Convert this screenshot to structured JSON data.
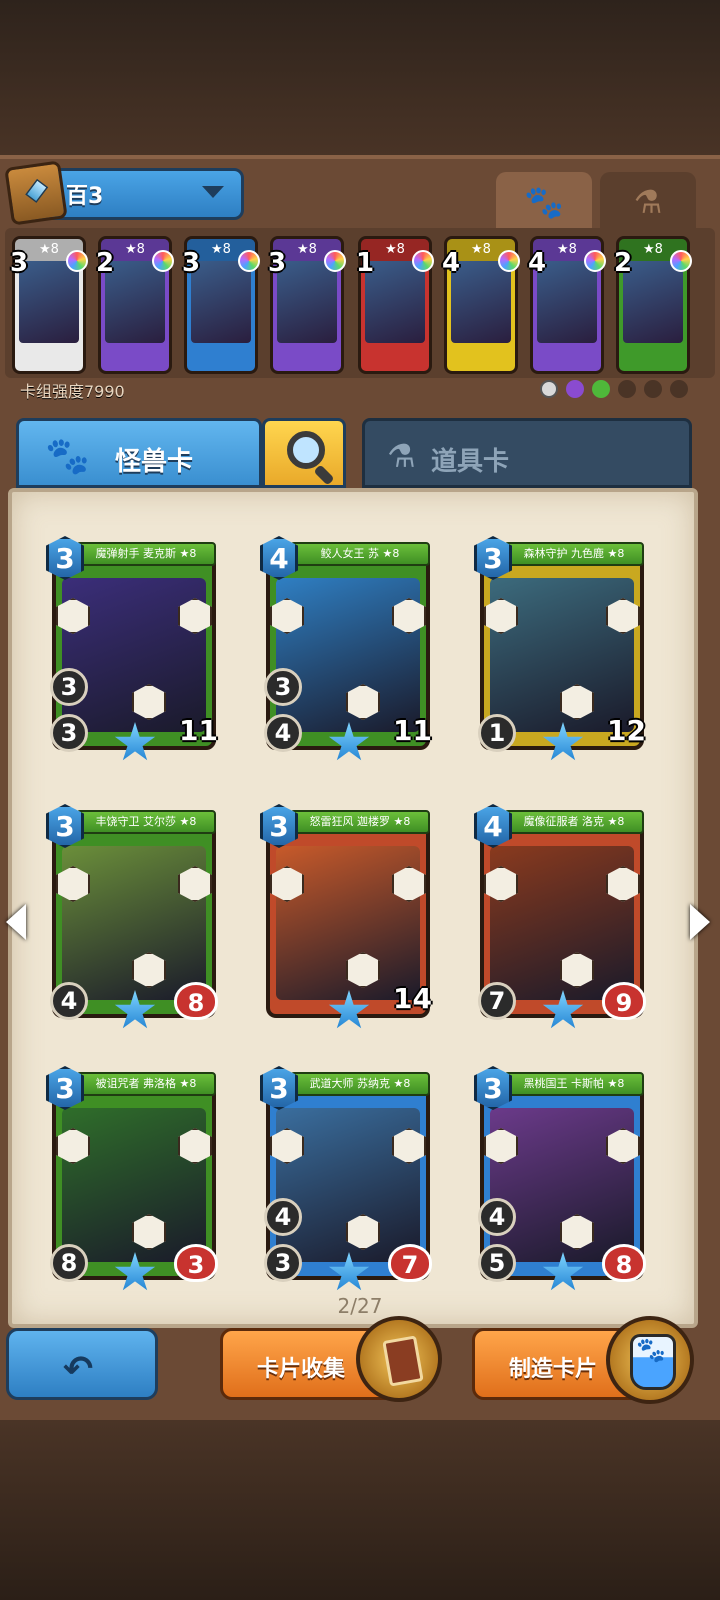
{
  "deck": {
    "name": "百3",
    "power_label": "卡组强度7990"
  },
  "top_tabs": {
    "paw_icon": "paw-icon",
    "potion_icon": "potion-icon"
  },
  "deck_cards": [
    {
      "cost": "3",
      "stars": "★8",
      "color": "#e9e9e9"
    },
    {
      "cost": "2",
      "stars": "★8",
      "color": "#7a4bc7"
    },
    {
      "cost": "3",
      "stars": "★8",
      "color": "#2f7fd0"
    },
    {
      "cost": "3",
      "stars": "★8",
      "color": "#7a4bc7"
    },
    {
      "cost": "1",
      "stars": "★8",
      "color": "#c8332f"
    },
    {
      "cost": "4",
      "stars": "★8",
      "color": "#e2c21e"
    },
    {
      "cost": "4",
      "stars": "★8",
      "color": "#7a4bc7"
    },
    {
      "cost": "2",
      "stars": "★8",
      "color": "#3f9a2a"
    }
  ],
  "category_tabs": {
    "monster": "怪兽卡",
    "item": "道具卡"
  },
  "cards": [
    {
      "cost": "3",
      "name": "魔弹射手 麦克斯 ★8",
      "atk": "3",
      "def": "3",
      "hp": "11",
      "border": "#3f8f24",
      "art": "#3b2e7a",
      "hp_heart": false
    },
    {
      "cost": "4",
      "name": "鲛人女王 苏 ★8",
      "atk": "3",
      "def": "4",
      "hp": "11",
      "border": "#3f8f24",
      "art": "#2f7fc3",
      "hp_heart": false
    },
    {
      "cost": "3",
      "name": "森林守护 九色鹿 ★8",
      "atk": "",
      "def": "1",
      "hp": "12",
      "border": "#c9a820",
      "art": "#3c6b7d",
      "hp_heart": false
    },
    {
      "cost": "3",
      "name": "丰饶守卫 艾尔莎 ★8",
      "atk": "",
      "def": "4",
      "hp": "8",
      "border": "#3f8f24",
      "art": "#6b8f3a",
      "hp_heart": true
    },
    {
      "cost": "3",
      "name": "怒雷狂风 迦楼罗 ★8",
      "atk": "",
      "def": "",
      "hp": "14",
      "border": "#c04a2a",
      "art": "#c85a2a",
      "hp_heart": false
    },
    {
      "cost": "4",
      "name": "魔像征服者 洛克 ★8",
      "atk": "",
      "def": "7",
      "hp": "9",
      "border": "#c04a2a",
      "art": "#8a3a1e",
      "hp_heart": true
    },
    {
      "cost": "3",
      "name": "被诅咒者 弗洛格 ★8",
      "atk": "",
      "def": "8",
      "hp": "3",
      "border": "#3f8f24",
      "art": "#2f6e2a",
      "hp_heart": true
    },
    {
      "cost": "3",
      "name": "武道大师 苏纳克 ★8",
      "atk": "4",
      "def": "3",
      "hp": "7",
      "border": "#2f7fd0",
      "art": "#3a6e9e",
      "hp_heart": true
    },
    {
      "cost": "3",
      "name": "黑桃国王 卡斯帕 ★8",
      "atk": "4",
      "def": "5",
      "hp": "8",
      "border": "#2f7fd0",
      "art": "#6b3a8a",
      "hp_heart": true
    }
  ],
  "pagination": {
    "label": "2/27"
  },
  "buttons": {
    "collect": "卡片收集",
    "craft": "制造卡片"
  }
}
